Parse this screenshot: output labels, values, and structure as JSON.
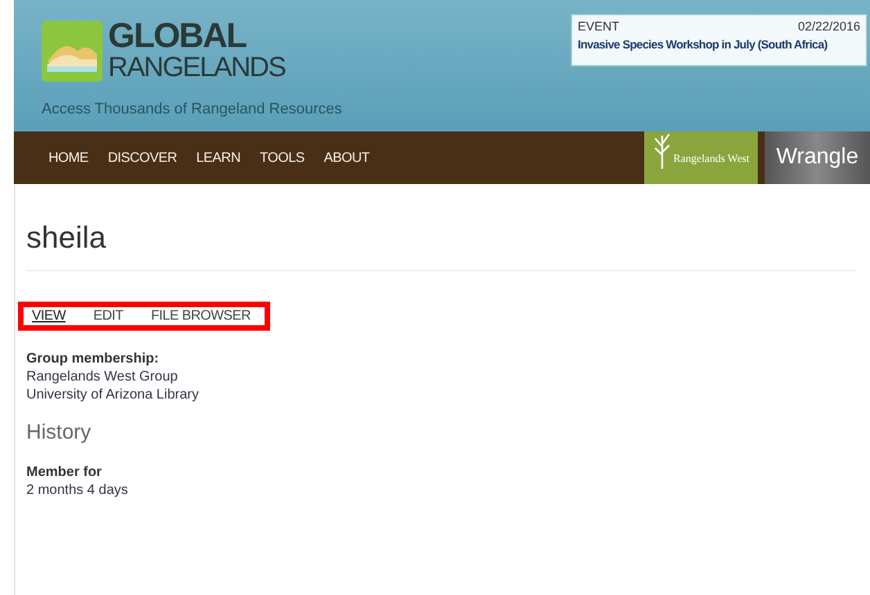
{
  "site": {
    "title_line_1": "GLOBAL",
    "title_line_2": "RANGELANDS",
    "tagline": "Access Thousands of Rangeland Resources"
  },
  "event": {
    "label": "EVENT",
    "date": "02/22/2016",
    "title": "Invasive Species Workshop in July (South Africa)"
  },
  "nav": [
    "HOME",
    "DISCOVER",
    "LEARN",
    "TOOLS",
    "ABOUT"
  ],
  "partners": [
    {
      "kind": "rangelands-west",
      "label": "Rangelands West"
    },
    {
      "kind": "wrangle",
      "label": "Wrangle"
    }
  ],
  "page_title": "sheila",
  "tabs": [
    {
      "label": "VIEW",
      "selected": true
    },
    {
      "label": "EDIT",
      "selected": false
    },
    {
      "label": "FILE BROWSER",
      "selected": false
    }
  ],
  "group_membership": {
    "heading": "Group membership:",
    "items": [
      "Rangelands West Group",
      "University of Arizona Library"
    ]
  },
  "history": {
    "heading": "History",
    "label": "Member for",
    "value": "2 months 4 days"
  }
}
